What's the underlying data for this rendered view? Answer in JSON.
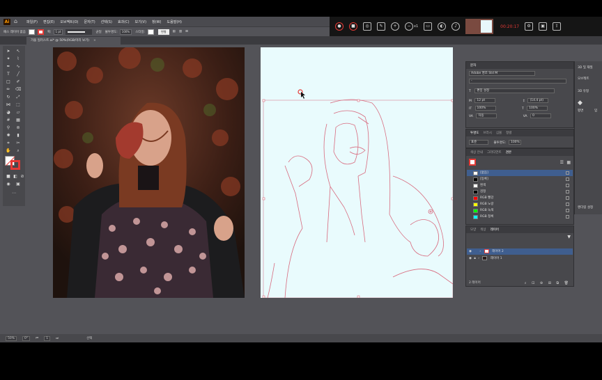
{
  "menubar": {
    "items": [
      "파일(F)",
      "편집(E)",
      "오브젝트(O)",
      "문자(T)",
      "선택(S)",
      "효과(C)",
      "보기(V)",
      "창(W)",
      "도움말(H)"
    ]
  },
  "control_bar": {
    "selection_label": "패스 레이어 없음",
    "stroke_label": "획:",
    "stroke_weight": "1 pt",
    "stroke_style": "균일",
    "opacity_label": "불투명도:",
    "opacity_value": "100%",
    "style_label": "스타일:",
    "transform_button": "변형"
  },
  "document_tab": {
    "title": "가을 일러스트.ai* @ 50%(RGB/미리 보기)",
    "close": "×"
  },
  "recorder": {
    "zoom_label": "x1",
    "timer": "00:20:17"
  },
  "status_bar": {
    "zoom": "50%",
    "rotation": "0°",
    "artboard_number": "1",
    "tool_name": "선택"
  },
  "character_panel": {
    "title": "문자",
    "font_family": "Adobe 명조 Std M",
    "font_style": "-",
    "search_label": "편집 설정",
    "size_value": "12 pt",
    "leading_value": "(14.4 pt)",
    "hscale_value": "100%",
    "vscale_value": "100%",
    "tracking_value": "자동",
    "kerning_value": "0"
  },
  "transparency_panel": {
    "tabs": [
      "투명도",
      "브러시",
      "심볼",
      "정렬"
    ],
    "blend_mode": "표준",
    "opacity_label": "불투명도:",
    "opacity_value": "100%"
  },
  "swatches_panel": {
    "tabs": [
      "색상 안내",
      "그라디언트",
      "견본"
    ],
    "items": [
      {
        "name": "[없음]",
        "color": "#ffffff"
      },
      {
        "name": "[등록]",
        "color": "#000000"
      },
      {
        "name": "흰색",
        "color": "#ffffff"
      },
      {
        "name": "검정",
        "color": "#000000"
      },
      {
        "name": "RGB 빨강",
        "color": "#ff0000"
      },
      {
        "name": "RGB 노랑",
        "color": "#ffff00"
      },
      {
        "name": "RGB 녹색",
        "color": "#00ff00"
      },
      {
        "name": "RGB 청록",
        "color": "#00ffff"
      }
    ]
  },
  "layers_panel": {
    "tabs": [
      "모양",
      "색상",
      "레이어"
    ],
    "layers": [
      {
        "name": "레이어 2",
        "selected": true
      },
      {
        "name": "레이어 1",
        "selected": false
      }
    ],
    "footer": "2 레이어"
  },
  "side_panel": {
    "title": "3D 및 재질",
    "sub1": "오브젝트",
    "sub2": "3D 유형",
    "labels": [
      "평면",
      "입"
    ],
    "footer": "렌더링 설정"
  },
  "colors": {
    "accent_red": "#e53935",
    "ui_dark": "#48484c",
    "artboard": "#e9fbfd",
    "outline": "#d86a7e"
  }
}
